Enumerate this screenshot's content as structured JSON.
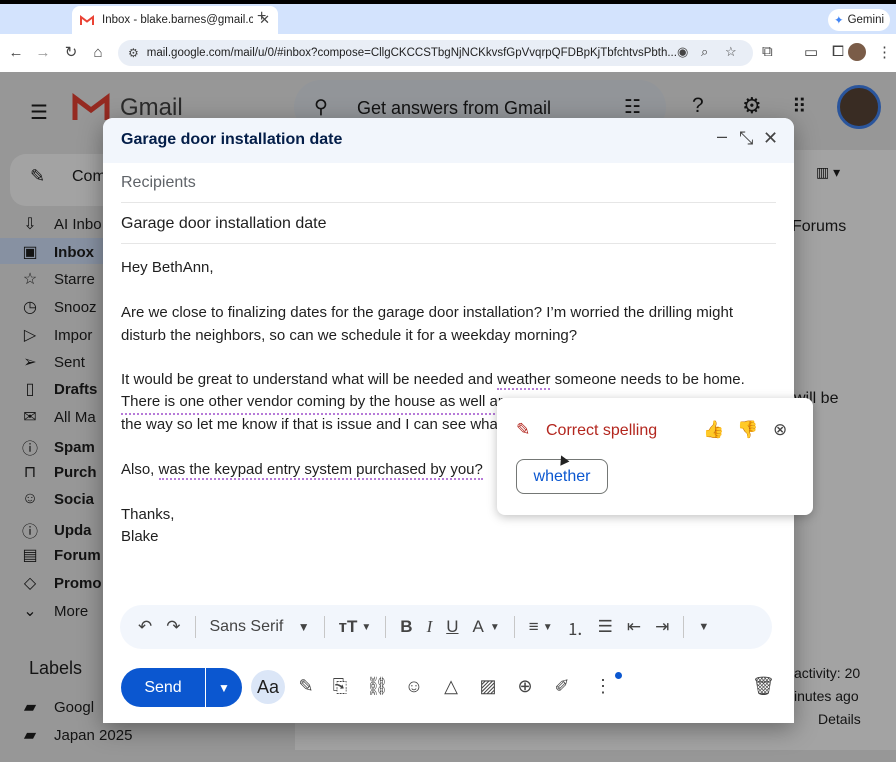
{
  "browser": {
    "tab_title": "Inbox - blake.barnes@gmail.c",
    "tab_close": "✕",
    "new_tab": "+",
    "gemini_label": "Gemini",
    "url": "mail.google.com/mail/u/0/#inbox?compose=CllgCKCCSTbgNjNCKkvsfGpVvqrpQFDBpKjTbfchtvsPbth..."
  },
  "gmail": {
    "logo_text": "Gmail",
    "search_placeholder": "Get answers from Gmail",
    "compose_label": "Com",
    "sidebar_items": [
      "AI Inbo",
      "Inbox",
      "Starre",
      "Snooz",
      "Impor",
      "Sent",
      "Drafts",
      "All Ma",
      "Spam",
      "Purch",
      "Socia",
      "Upda",
      "Forum",
      "Promo",
      "More"
    ],
    "labels_heading": "Labels",
    "labels": [
      "Googl",
      "Japan 2025"
    ],
    "right_tab": "Forums",
    "right_text": "will be",
    "activity_line1": "activity: 20",
    "activity_line2": "inutes ago",
    "details": "Details"
  },
  "compose": {
    "title": "Garage door installation date",
    "recipients_placeholder": "Recipients",
    "subject": "Garage door installation date",
    "body": {
      "greeting": "Hey BethAnn,",
      "p1_line1": "Are we close to finalizing dates for the garage door installation? I’m worried the drilling might",
      "p1_line2": "disturb the neighbors, so can we schedule it for a weekday morning?",
      "p2_line1_a": "It would be great to understand what will be needed and ",
      "p2_line1_word": "weather",
      "p2_line1_b": " someone needs to be home.",
      "p2_line2": "There is one other vendor coming by the house as well ar",
      "p2_line3": "the way so let me know if that is issue and I can see wha",
      "p3_a": "Also, ",
      "p3_b": "was the keypad entry system purchased by you?",
      "signoff": "Thanks,",
      "name": "Blake"
    },
    "font_name": "Sans Serif",
    "send_label": "Send",
    "aa_label": "Aa"
  },
  "spelling_popup": {
    "title": "Correct spelling",
    "suggestion": "whether"
  }
}
